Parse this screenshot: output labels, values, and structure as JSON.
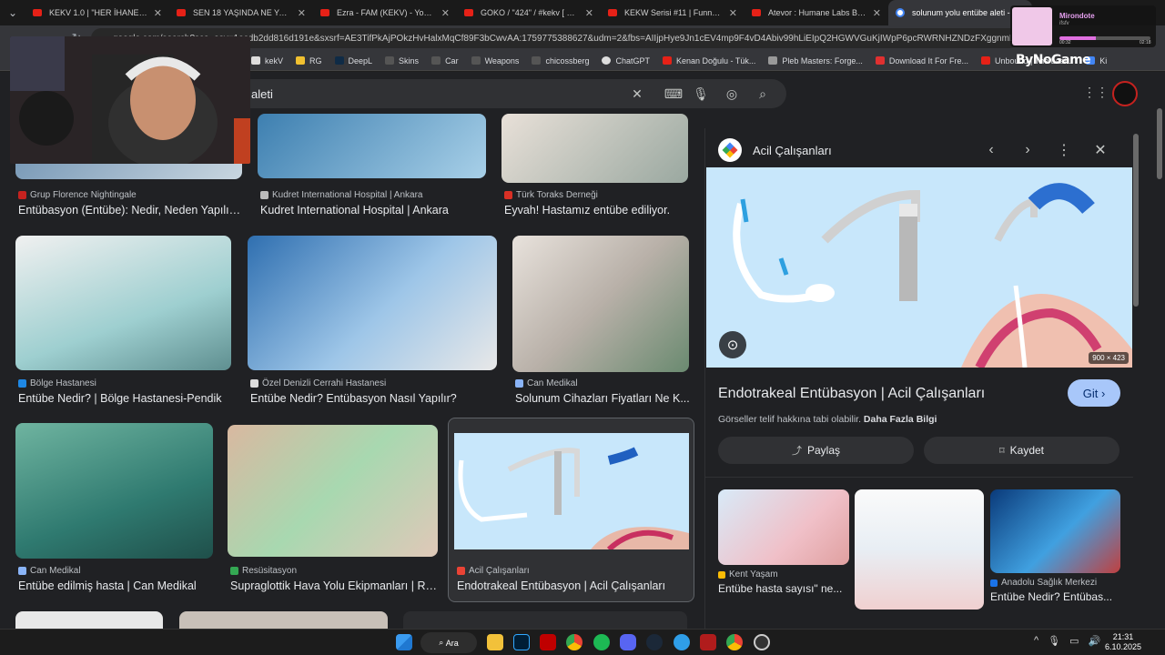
{
  "tabs": [
    {
      "title": "KEKV 1.0 | \"HER İHANET, SEVGİ",
      "active": false
    },
    {
      "title": "SEN 18 YAŞINDA NE YAPIYORD",
      "active": false
    },
    {
      "title": "Ezra - FAM (KEKV) - YouTube",
      "active": false
    },
    {
      "title": "GOKO / \"424\" / #kekv [ SON ]",
      "active": false
    },
    {
      "title": "KEKW Serisi #11 | Funny Mome",
      "active": false
    },
    {
      "title": "Atevor : Humane Labs Baskını",
      "active": false
    },
    {
      "title": "solunum yolu entübe aleti - Go",
      "active": true
    }
  ],
  "address": {
    "url": "google.com/search?sca_esv=1ecdb2dd816d191e&sxsrf=AE3TifPkAjPOkzHvHalxMqCf89F3bCwvAA:1759775388627&udm=2&fbs=AIIjpHye9Jn1cEV4mp9F4vD4Abiv99hLiEIpQ2HGWVGuKjIWpP6pcRWRNHZNDzFXggnmL--qoLS"
  },
  "bookmarks": [
    "kekV",
    "RG",
    "DeepL",
    "Skins",
    "Car",
    "Weapons",
    "chicossberg",
    "ChatGPT",
    "Kenan Doğulu - Tük...",
    "Pleb Masters: Forge...",
    "Download It For Fre...",
    "Unbound | The Last...",
    "Ki"
  ],
  "search": {
    "query": "aleti"
  },
  "results": [
    {
      "source": "Grup Florence Nightingale",
      "caption": "Entübasyon (Entübe): Nedir, Neden Yapılır ..."
    },
    {
      "source": "Kudret International Hospital | Ankara",
      "caption": "Kudret International Hospital | Ankara"
    },
    {
      "source": "Türk Toraks Derneği",
      "caption": "Eyvah! Hastamız entübe ediliyor."
    },
    {
      "source": "Bölge Hastanesi",
      "caption": "Entübe Nedir? | Bölge Hastanesi-Pendik"
    },
    {
      "source": "Özel Denizli Cerrahi Hastanesi",
      "caption": "Entübe Nedir? Entübasyon Nasıl Yapılır?"
    },
    {
      "source": "Can Medikal",
      "caption": "Solunum Cihazları Fiyatları Ne K..."
    },
    {
      "source": "Can Medikal",
      "caption": "Entübe edilmiş hasta | Can Medikal"
    },
    {
      "source": "Resüsitasyon",
      "caption": "Supraglottik Hava Yolu Ekipmanları | Re..."
    },
    {
      "source": "Acil Çalışanları",
      "caption": "Endotrakeal Entübasyon | Acil Çalışanları"
    }
  ],
  "panel": {
    "site": "Acil Çalışanları",
    "dims": "900 × 423",
    "title": "Endotrakeal Entübasyon | Acil Çalışanları",
    "visit": "Git",
    "copyright": "Görseller telif hakkına tabi olabilir.",
    "more": "Daha Fazla Bilgi",
    "share": "Paylaş",
    "save": "Kaydet",
    "related": [
      {
        "source": "Kent Yaşam",
        "caption": "Entübe hasta sayısı\" ne..."
      },
      {
        "source": "",
        "caption": ""
      },
      {
        "source": "Anadolu Sağlık Merkezi",
        "caption": "Entübe Nedir? Entübas..."
      }
    ]
  },
  "taskbar": {
    "search": "Ara",
    "time": "21:31",
    "date": "6.10.2025"
  },
  "overlay": {
    "name": "Mirondote",
    "sub": "ifsfv",
    "t_left": "00:32",
    "t_right": "02:18",
    "brand": "ByNoGame"
  }
}
